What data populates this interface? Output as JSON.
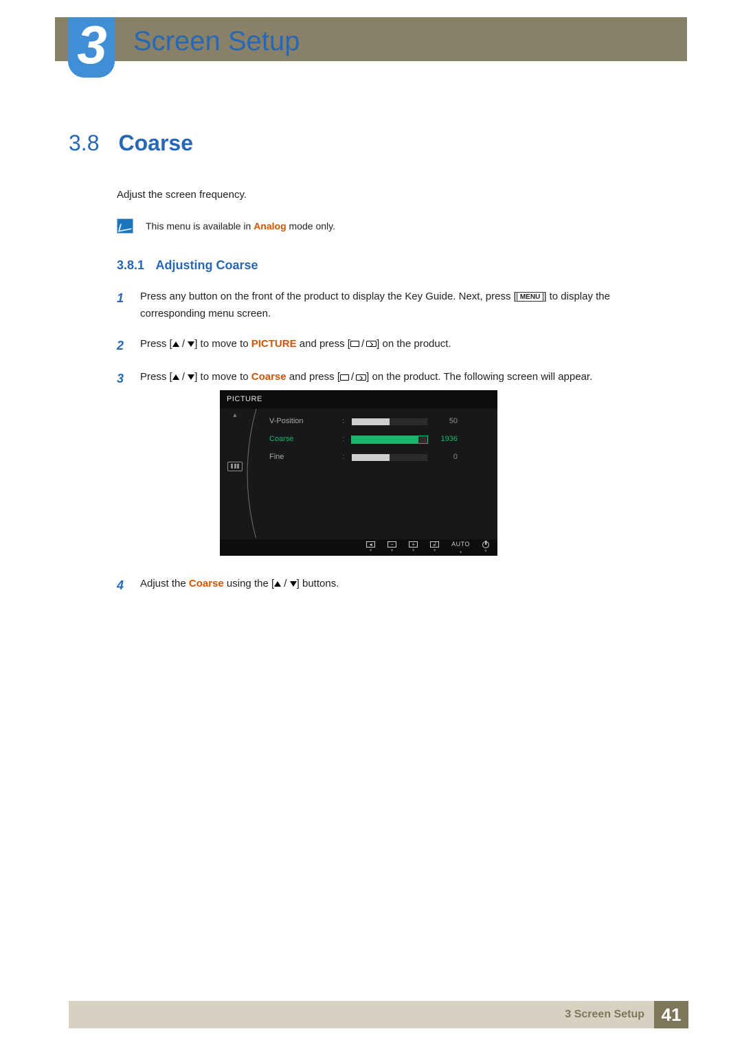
{
  "chapter": {
    "number": "3",
    "title": "Screen Setup"
  },
  "section": {
    "number": "3.8",
    "title": "Coarse"
  },
  "intro": "Adjust the screen frequency.",
  "note": {
    "prefix": "This menu is available in ",
    "mode": "Analog",
    "suffix": " mode only."
  },
  "subsection": {
    "number": "3.8.1",
    "title": "Adjusting Coarse"
  },
  "steps": {
    "s1": {
      "num": "1",
      "a": "Press any button on the front of the product to display the Key Guide. Next, press [",
      "menu": "MENU",
      "b": "] to display the corresponding menu screen."
    },
    "s2": {
      "num": "2",
      "a": "Press [",
      "b": "] to move to ",
      "kw": "PICTURE",
      "c": " and press [",
      "d": "] on the product."
    },
    "s3": {
      "num": "3",
      "a": "Press [",
      "b": "] to move to ",
      "kw": "Coarse",
      "c": " and press [",
      "d": "] on the product. The following screen will appear."
    },
    "s4": {
      "num": "4",
      "a": "Adjust the ",
      "kw": "Coarse",
      "b": " using the [",
      "c": "] buttons."
    }
  },
  "osd": {
    "title": "PICTURE",
    "rows": [
      {
        "label": "V-Position",
        "value": "50",
        "fill_pct": 50,
        "active": false
      },
      {
        "label": "Coarse",
        "value": "1936",
        "fill_pct": 88,
        "active": true
      },
      {
        "label": "Fine",
        "value": "0",
        "fill_pct": 50,
        "active": false
      }
    ],
    "footer": {
      "auto": "AUTO"
    }
  },
  "footer": {
    "text": "3 Screen Setup",
    "page": "41"
  }
}
